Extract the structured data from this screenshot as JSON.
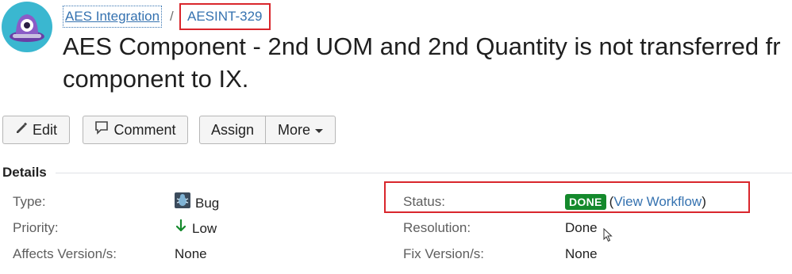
{
  "breadcrumb": {
    "project": "AES Integration",
    "separator": "/",
    "issue_key": "AESINT-329"
  },
  "issue": {
    "title_line1": "AES Component - 2nd UOM and 2nd Quantity is not transferred fr",
    "title_line2": "component to IX."
  },
  "toolbar": {
    "edit_label": "Edit",
    "comment_label": "Comment",
    "assign_label": "Assign",
    "more_label": "More"
  },
  "details": {
    "heading": "Details",
    "type_label": "Type:",
    "type_value": "Bug",
    "priority_label": "Priority:",
    "priority_value": "Low",
    "affects_label": "Affects Version/s:",
    "affects_value": "None",
    "status_label": "Status:",
    "status_value": "DONE",
    "status_open_paren": "(",
    "status_link": "View Workflow",
    "status_close_paren": ")",
    "resolution_label": "Resolution:",
    "resolution_value": "Done",
    "fix_label": "Fix Version/s:",
    "fix_value": "None"
  },
  "colors": {
    "link": "#3572b0",
    "done_lozenge": "#14892c",
    "highlight_box": "#d9262c",
    "priority_low_arrow": "#14892c"
  },
  "icons": {
    "avatar": "project-avatar-alien-icon",
    "edit": "pencil-icon",
    "comment": "speech-bubble-icon",
    "more": "caret-down-icon",
    "type": "bug-icon",
    "priority": "arrow-down-icon",
    "cursor": "mouse-pointer-icon"
  }
}
